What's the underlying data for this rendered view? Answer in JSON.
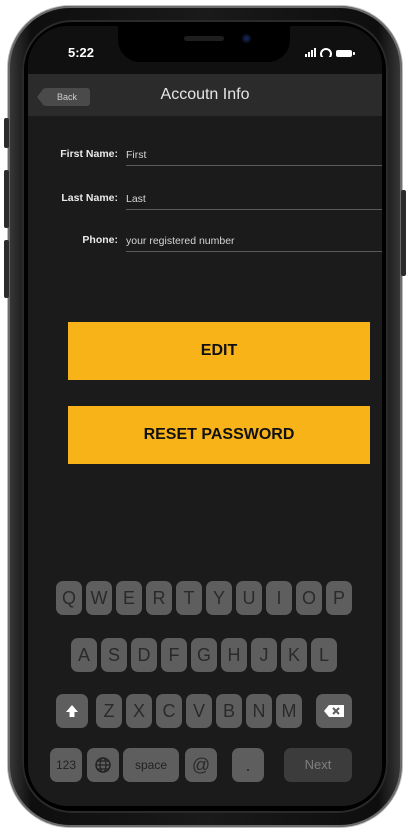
{
  "status_bar": {
    "time": "5:22"
  },
  "nav": {
    "back_label": "Back",
    "title": "Accoutn Info"
  },
  "form": {
    "first_name": {
      "label": "First Name:",
      "value": "First"
    },
    "last_name": {
      "label": "Last Name:",
      "value": "Last"
    },
    "phone": {
      "label": "Phone:",
      "value": "your registered number"
    }
  },
  "buttons": {
    "edit": "EDIT",
    "reset_password": "RESET PASSWORD"
  },
  "keyboard": {
    "row1": [
      "Q",
      "W",
      "E",
      "R",
      "T",
      "Y",
      "U",
      "I",
      "O",
      "P"
    ],
    "row2": [
      "A",
      "S",
      "D",
      "F",
      "G",
      "H",
      "J",
      "K",
      "L"
    ],
    "row3": [
      "Z",
      "X",
      "C",
      "V",
      "B",
      "N",
      "M"
    ],
    "numbers_key": "123",
    "space_key": "space",
    "at_key": "@",
    "period_key": ".",
    "next_key": "Next"
  },
  "colors": {
    "accent": "#f8b319",
    "background": "#1b1b1b",
    "nav_bar": "#2b2b2b",
    "key": "#5e5e5e"
  }
}
